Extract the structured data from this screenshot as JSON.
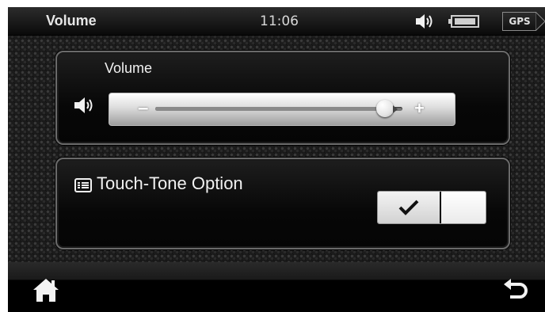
{
  "header": {
    "title": "Volume",
    "time": "11:06",
    "gps_label": "GPS",
    "speaker_icon": "speaker-icon",
    "battery_icon": "battery-icon"
  },
  "volume_panel": {
    "label": "Volume",
    "speaker_icon": "speaker-icon",
    "minus_label": "–",
    "plus_label": "+",
    "level": 0.93
  },
  "touch_panel": {
    "label": "Touch-Tone Option",
    "icon": "list-icon",
    "toggle_checked": true
  },
  "bottom": {
    "home_icon": "home-icon",
    "back_icon": "back-arrow-icon"
  },
  "colors": {
    "background": "#121212",
    "text": "#f0f0f0",
    "accent": "#8a8a8a"
  }
}
